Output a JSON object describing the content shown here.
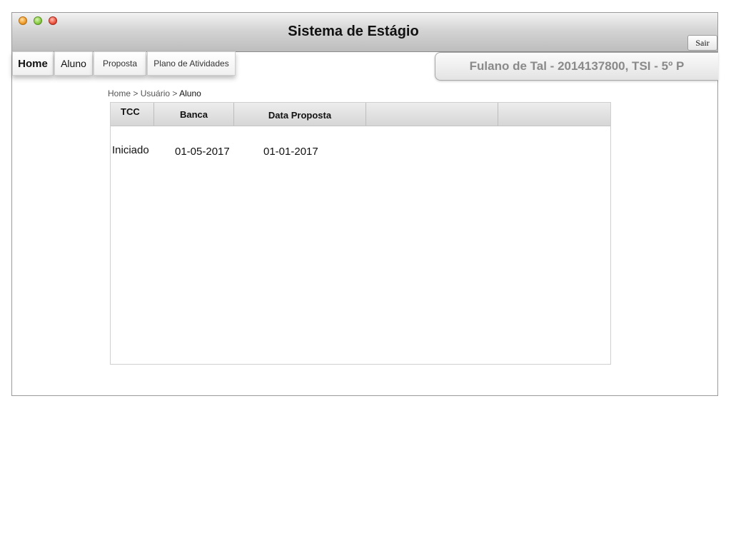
{
  "window": {
    "title": "Sistema de Estágio"
  },
  "header": {
    "logout_label": "Sair"
  },
  "nav": {
    "tabs": [
      {
        "label": "Home"
      },
      {
        "label": "Aluno"
      },
      {
        "label": "Proposta"
      },
      {
        "label": "Plano de Atividades"
      }
    ]
  },
  "user": {
    "info": "Fulano de Tal - 2014137800, TSI - 5º P"
  },
  "breadcrumb": {
    "home": "Home",
    "sep1": ">",
    "usuario": "Usuário",
    "sep2": ">",
    "current": "Aluno"
  },
  "table": {
    "columns": [
      "TCC",
      "Banca",
      "Data Proposta",
      "",
      ""
    ],
    "rows": [
      {
        "tcc": "Iniciado",
        "banca": "01-05-2017",
        "data_proposta": "01-01-2017"
      }
    ]
  }
}
